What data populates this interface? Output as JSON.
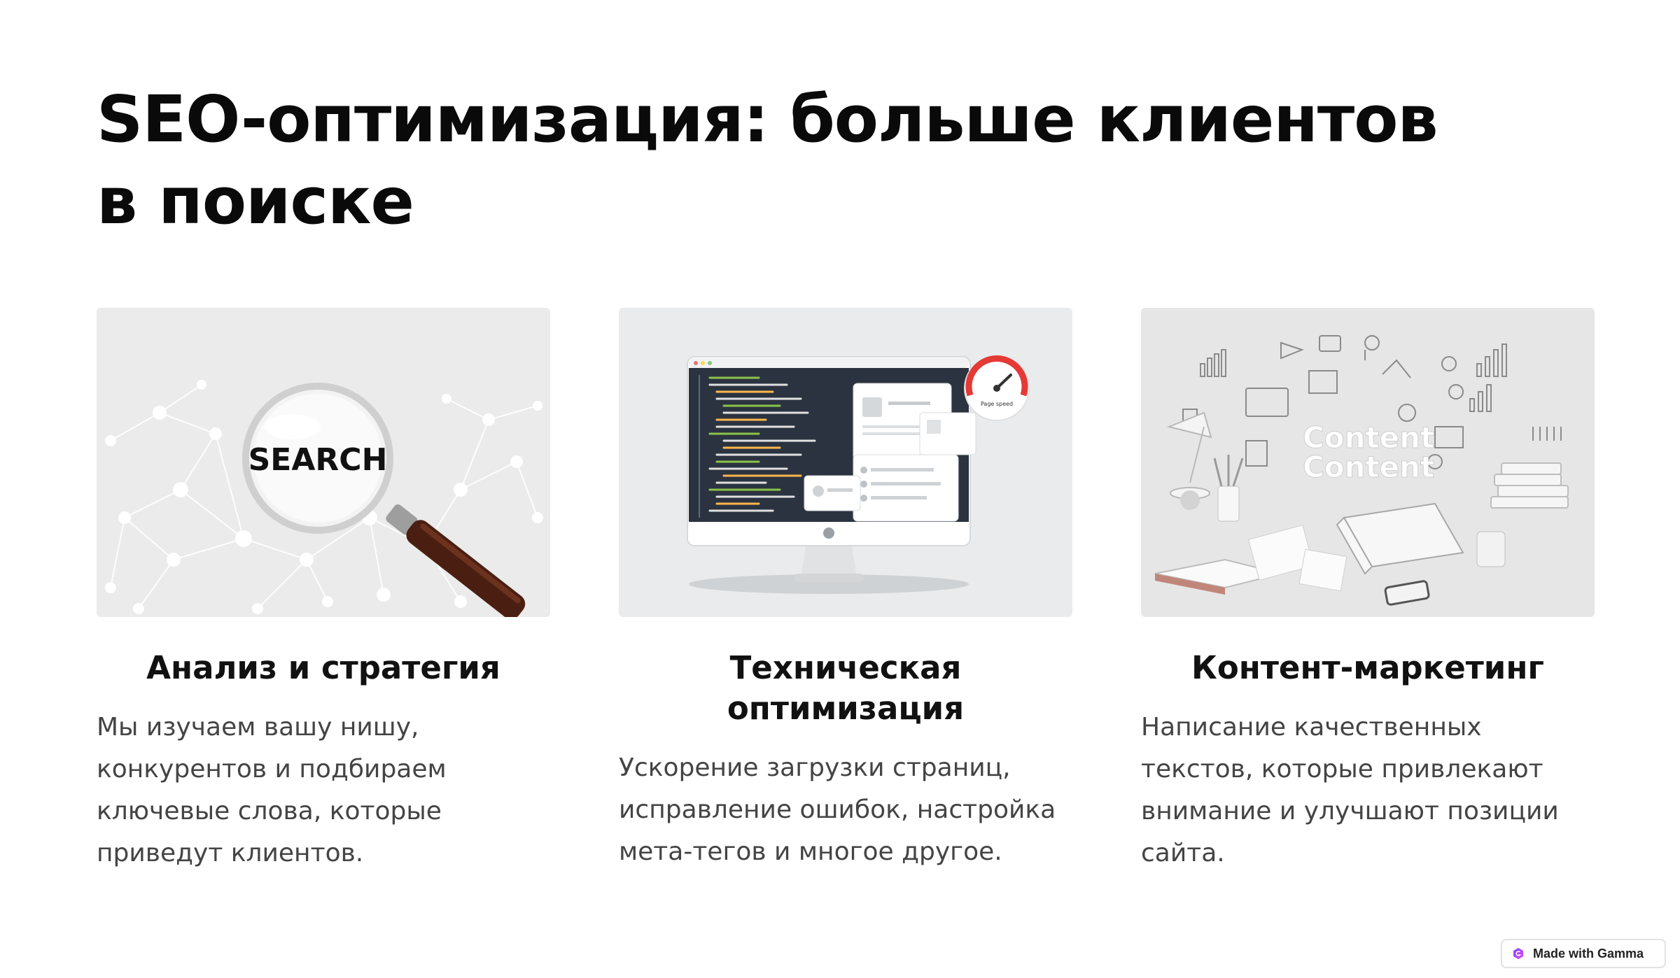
{
  "page": {
    "title": "SEO-оптимизация: больше клиентов в поиске"
  },
  "cards": [
    {
      "heading": "Анализ и стратегия",
      "body": "Мы изучаем вашу нишу, конкурентов и подбираем ключевые слова, которые приведут клиентов.",
      "image_text": "SEARCH",
      "image_icon": "magnifying-glass-network-image"
    },
    {
      "heading": "Техническая оптимизация",
      "body": "Ускорение загрузки страниц, исправление ошибок, настройка мета-тегов и многое другое.",
      "image_text": "Page speed",
      "image_icon": "monitor-code-speedometer-image"
    },
    {
      "heading": "Контент-маркетинг",
      "body": "Написание качественных текстов, которые привлекают внимание и улучшают позиции сайта.",
      "image_text": "Content",
      "image_text_2": "Content",
      "image_icon": "content-workspace-image"
    }
  ],
  "badge": {
    "label": "Made with Gamma",
    "icon": "gamma-logo-icon"
  },
  "colors": {
    "title": "#0a0a0a",
    "body_text": "#444444",
    "image_bg": "#e8e9ea",
    "accent_red": "#e53935",
    "magnifier_handle": "#4a1f12"
  }
}
